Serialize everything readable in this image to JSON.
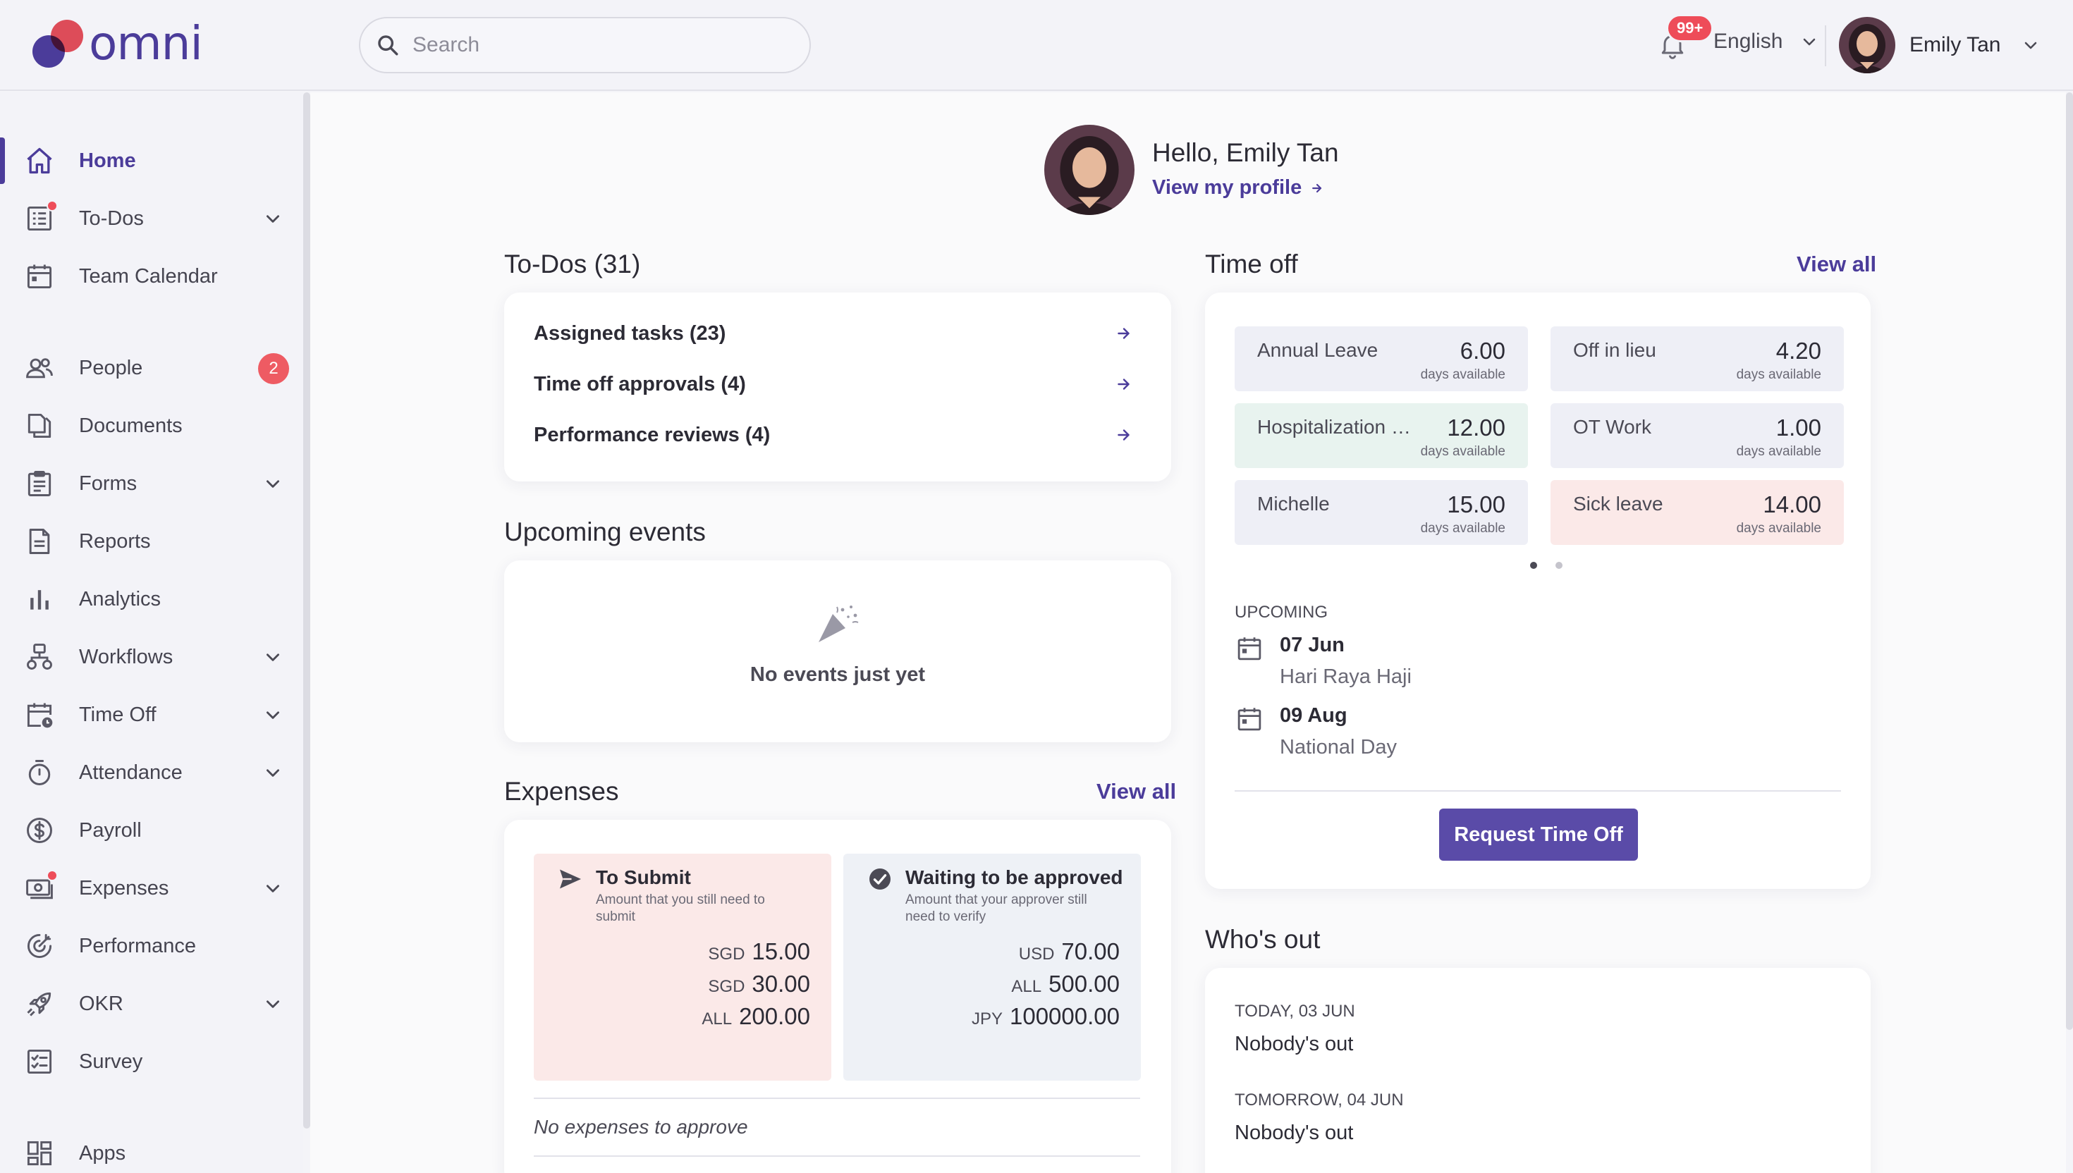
{
  "brand": {
    "name": "omni",
    "primary": "#4b3c9a",
    "accent": "#e8505b"
  },
  "header": {
    "search_placeholder": "Search",
    "notifications_badge": "99+",
    "language": "English",
    "user_name": "Emily Tan"
  },
  "sidebar": {
    "items": [
      {
        "label": "Home",
        "icon": "home-icon",
        "active": true
      },
      {
        "label": "To-Dos",
        "icon": "todo-list-icon",
        "has_dot": true,
        "expandable": true
      },
      {
        "label": "Team Calendar",
        "icon": "calendar-icon"
      },
      {
        "label": "People",
        "icon": "people-icon",
        "count": "2"
      },
      {
        "label": "Documents",
        "icon": "documents-icon"
      },
      {
        "label": "Forms",
        "icon": "clipboard-icon",
        "expandable": true
      },
      {
        "label": "Reports",
        "icon": "report-icon"
      },
      {
        "label": "Analytics",
        "icon": "bar-chart-icon"
      },
      {
        "label": "Workflows",
        "icon": "workflow-icon",
        "expandable": true
      },
      {
        "label": "Time Off",
        "icon": "calendar-clock-icon",
        "expandable": true
      },
      {
        "label": "Attendance",
        "icon": "stopwatch-icon",
        "expandable": true
      },
      {
        "label": "Payroll",
        "icon": "dollar-icon"
      },
      {
        "label": "Expenses",
        "icon": "cash-icon",
        "has_dot": true,
        "expandable": true
      },
      {
        "label": "Performance",
        "icon": "target-icon"
      },
      {
        "label": "OKR",
        "icon": "rocket-icon",
        "expandable": true
      },
      {
        "label": "Survey",
        "icon": "checklist-icon"
      },
      {
        "label": "Apps",
        "icon": "apps-grid-icon"
      }
    ]
  },
  "greeting": {
    "title": "Hello, Emily Tan",
    "profile_link": "View my profile"
  },
  "todos": {
    "title": "To-Dos (31)",
    "rows": [
      "Assigned tasks (23)",
      "Time off approvals (4)",
      "Performance reviews (4)"
    ]
  },
  "events": {
    "title": "Upcoming events",
    "empty": "No events just yet"
  },
  "expenses": {
    "title": "Expenses",
    "view_all": "View all",
    "to_submit": {
      "title": "To Submit",
      "subtitle": "Amount that you still need to submit",
      "amounts": [
        {
          "currency": "SGD",
          "value": "15.00"
        },
        {
          "currency": "SGD",
          "value": "30.00"
        },
        {
          "currency": "ALL",
          "value": "200.00"
        }
      ]
    },
    "waiting": {
      "title": "Waiting to be approved",
      "subtitle": "Amount that your approver still need to verify",
      "amounts": [
        {
          "currency": "USD",
          "value": "70.00"
        },
        {
          "currency": "ALL",
          "value": "500.00"
        },
        {
          "currency": "JPY",
          "value": "100000.00"
        }
      ]
    },
    "none_to_approve": "No expenses to approve"
  },
  "time_off": {
    "title": "Time off",
    "view_all": "View all",
    "balances": [
      {
        "name": "Annual Leave",
        "value": "6.00",
        "unit": "days available",
        "color": "#eeeff6"
      },
      {
        "name": "Off in lieu",
        "value": "4.20",
        "unit": "days available",
        "color": "#eeeff6"
      },
      {
        "name": "Hospitalization Leave",
        "value": "12.00",
        "unit": "days available",
        "color": "#e8f3ef"
      },
      {
        "name": "OT Work",
        "value": "1.00",
        "unit": "days available",
        "color": "#eeeff6"
      },
      {
        "name": "Michelle",
        "value": "15.00",
        "unit": "days available",
        "color": "#eeeff6"
      },
      {
        "name": "Sick leave",
        "value": "14.00",
        "unit": "days available",
        "color": "#fbe9e8"
      }
    ],
    "page": 1,
    "pages": 2,
    "upcoming_label": "UPCOMING",
    "holidays": [
      {
        "date": "07 Jun",
        "name": "Hari Raya Haji"
      },
      {
        "date": "09 Aug",
        "name": "National Day"
      }
    ],
    "request_button": "Request Time Off"
  },
  "whos_out": {
    "title": "Who's out",
    "days": [
      {
        "label": "TODAY, 03 JUN",
        "text": "Nobody's out"
      },
      {
        "label": "TOMORROW, 04 JUN",
        "text": "Nobody's out"
      }
    ]
  }
}
